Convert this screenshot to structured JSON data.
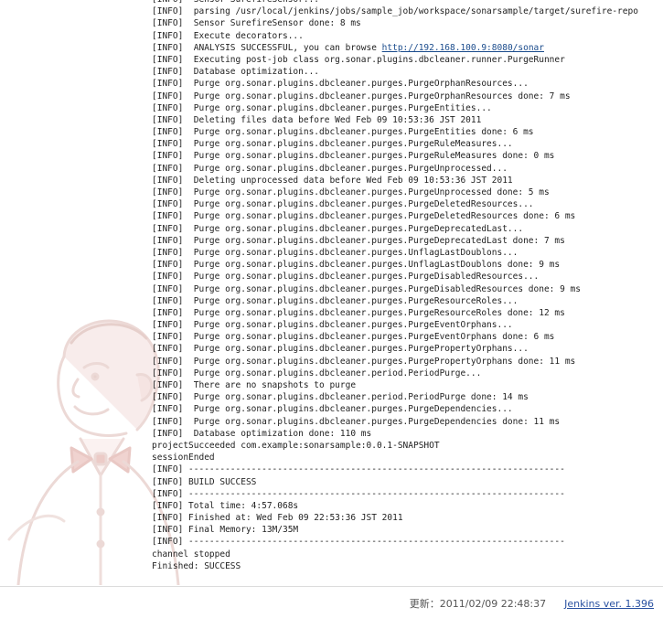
{
  "console": {
    "lines": [
      {
        "text": "[INFO]  Sensor SurefireSensor..."
      },
      {
        "text": "[INFO]  parsing /usr/local/jenkins/jobs/sample_job/workspace/sonarsample/target/surefire-repo"
      },
      {
        "text": "[INFO]  Sensor SurefireSensor done: 8 ms"
      },
      {
        "text": "[INFO]  Execute decorators..."
      },
      {
        "text": "[INFO]  ANALYSIS SUCCESSFUL, you can browse ",
        "link": "http://192.168.100.9:8080/sonar"
      },
      {
        "text": "[INFO]  Executing post-job class org.sonar.plugins.dbcleaner.runner.PurgeRunner"
      },
      {
        "text": "[INFO]  Database optimization..."
      },
      {
        "text": "[INFO]  Purge org.sonar.plugins.dbcleaner.purges.PurgeOrphanResources..."
      },
      {
        "text": "[INFO]  Purge org.sonar.plugins.dbcleaner.purges.PurgeOrphanResources done: 7 ms"
      },
      {
        "text": "[INFO]  Purge org.sonar.plugins.dbcleaner.purges.PurgeEntities..."
      },
      {
        "text": "[INFO]  Deleting files data before Wed Feb 09 10:53:36 JST 2011"
      },
      {
        "text": "[INFO]  Purge org.sonar.plugins.dbcleaner.purges.PurgeEntities done: 6 ms"
      },
      {
        "text": "[INFO]  Purge org.sonar.plugins.dbcleaner.purges.PurgeRuleMeasures..."
      },
      {
        "text": "[INFO]  Purge org.sonar.plugins.dbcleaner.purges.PurgeRuleMeasures done: 0 ms"
      },
      {
        "text": "[INFO]  Purge org.sonar.plugins.dbcleaner.purges.PurgeUnprocessed..."
      },
      {
        "text": "[INFO]  Deleting unprocessed data before Wed Feb 09 10:53:36 JST 2011"
      },
      {
        "text": "[INFO]  Purge org.sonar.plugins.dbcleaner.purges.PurgeUnprocessed done: 5 ms"
      },
      {
        "text": "[INFO]  Purge org.sonar.plugins.dbcleaner.purges.PurgeDeletedResources..."
      },
      {
        "text": "[INFO]  Purge org.sonar.plugins.dbcleaner.purges.PurgeDeletedResources done: 6 ms"
      },
      {
        "text": "[INFO]  Purge org.sonar.plugins.dbcleaner.purges.PurgeDeprecatedLast..."
      },
      {
        "text": "[INFO]  Purge org.sonar.plugins.dbcleaner.purges.PurgeDeprecatedLast done: 7 ms"
      },
      {
        "text": "[INFO]  Purge org.sonar.plugins.dbcleaner.purges.UnflagLastDoublons..."
      },
      {
        "text": "[INFO]  Purge org.sonar.plugins.dbcleaner.purges.UnflagLastDoublons done: 9 ms"
      },
      {
        "text": "[INFO]  Purge org.sonar.plugins.dbcleaner.purges.PurgeDisabledResources..."
      },
      {
        "text": "[INFO]  Purge org.sonar.plugins.dbcleaner.purges.PurgeDisabledResources done: 9 ms"
      },
      {
        "text": "[INFO]  Purge org.sonar.plugins.dbcleaner.purges.PurgeResourceRoles..."
      },
      {
        "text": "[INFO]  Purge org.sonar.plugins.dbcleaner.purges.PurgeResourceRoles done: 12 ms"
      },
      {
        "text": "[INFO]  Purge org.sonar.plugins.dbcleaner.purges.PurgeEventOrphans..."
      },
      {
        "text": "[INFO]  Purge org.sonar.plugins.dbcleaner.purges.PurgeEventOrphans done: 6 ms"
      },
      {
        "text": "[INFO]  Purge org.sonar.plugins.dbcleaner.purges.PurgePropertyOrphans..."
      },
      {
        "text": "[INFO]  Purge org.sonar.plugins.dbcleaner.purges.PurgePropertyOrphans done: 11 ms"
      },
      {
        "text": "[INFO]  Purge org.sonar.plugins.dbcleaner.period.PeriodPurge..."
      },
      {
        "text": "[INFO]  There are no snapshots to purge"
      },
      {
        "text": "[INFO]  Purge org.sonar.plugins.dbcleaner.period.PeriodPurge done: 14 ms"
      },
      {
        "text": "[INFO]  Purge org.sonar.plugins.dbcleaner.purges.PurgeDependencies..."
      },
      {
        "text": "[INFO]  Purge org.sonar.plugins.dbcleaner.purges.PurgeDependencies done: 11 ms"
      },
      {
        "text": "[INFO]  Database optimization done: 110 ms"
      },
      {
        "text": "projectSucceeded com.example:sonarsample:0.0.1-SNAPSHOT"
      },
      {
        "text": "sessionEnded"
      },
      {
        "text": "[INFO] ------------------------------------------------------------------------"
      },
      {
        "text": "[INFO] BUILD SUCCESS"
      },
      {
        "text": "[INFO] ------------------------------------------------------------------------"
      },
      {
        "text": "[INFO] Total time: 4:57.068s"
      },
      {
        "text": "[INFO] Finished at: Wed Feb 09 22:53:36 JST 2011"
      },
      {
        "text": "[INFO] Final Memory: 13M/35M"
      },
      {
        "text": "[INFO] ------------------------------------------------------------------------"
      },
      {
        "text": "channel stopped"
      },
      {
        "text": "Finished: SUCCESS"
      }
    ]
  },
  "footer": {
    "updated_label": "更新：2011/02/09 22:48:37",
    "version_link": "Jenkins ver. 1.396"
  },
  "icons": {
    "mascot": "jenkins-butler-icon"
  }
}
